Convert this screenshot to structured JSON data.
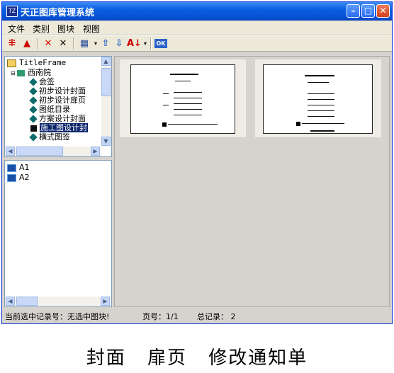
{
  "window": {
    "title": "天正图库管理系统",
    "app_icon": "TZ",
    "controls": [
      "minimize-icon",
      "maximize-icon",
      "close-icon"
    ]
  },
  "menu": [
    "文件",
    "类别",
    "图块",
    "视图"
  ],
  "tree": {
    "root": "TitleFrame",
    "group": "西南院",
    "items": [
      "会签",
      "初步设计封面",
      "初步设计扉页",
      "图纸目录",
      "方案设计封面",
      "施工图设计封",
      "横式图签"
    ],
    "selected_index": 5
  },
  "blocks": [
    "A1",
    "A2"
  ],
  "previews": [
    "title-cover-preview",
    "title-page-preview"
  ],
  "status": {
    "current": "当前选中记录号：无选中图块!",
    "page": "页号：1/1",
    "total": "总记录： 2"
  },
  "caption": "封面 扉页 修改通知单"
}
